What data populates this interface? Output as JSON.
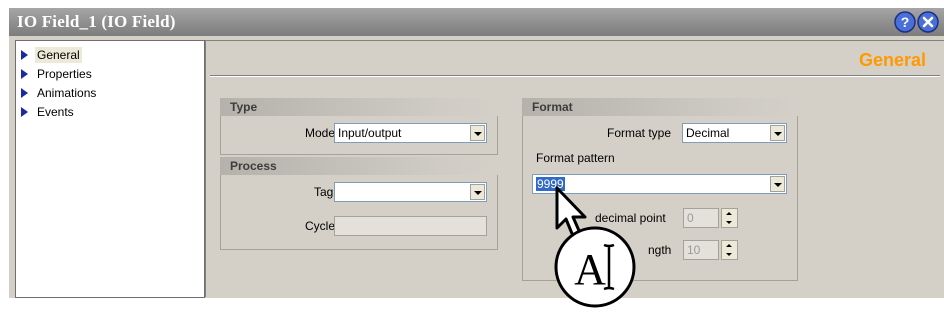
{
  "window": {
    "title": "IO Field_1 (IO Field)",
    "help_icon": "pin-help-icon",
    "close_icon": "close-icon"
  },
  "nav": {
    "items": [
      {
        "label": "General",
        "selected": true
      },
      {
        "label": "Properties",
        "selected": false
      },
      {
        "label": "Animations",
        "selected": false
      },
      {
        "label": "Events",
        "selected": false
      }
    ]
  },
  "panel": {
    "title": "General",
    "type_group": {
      "header": "Type",
      "mode_label": "Mode",
      "mode_value": "Input/output"
    },
    "process_group": {
      "header": "Process",
      "tag_label": "Tag",
      "tag_value": "",
      "cycle_label": "Cycle",
      "cycle_value": ""
    },
    "format_group": {
      "header": "Format",
      "format_type_label": "Format type",
      "format_type_value": "Decimal",
      "format_pattern_label": "Format pattern",
      "format_pattern_value": "9999",
      "decimal_point_label": "decimal point",
      "decimal_point_value": "0",
      "length_label": "ngth",
      "length_value": "10"
    }
  },
  "overlay": {
    "cursor_letter": "A"
  },
  "colors": {
    "accent_title": "#ff9900",
    "nav_arrow": "#1b2b9e",
    "selection": "#316ac5"
  }
}
